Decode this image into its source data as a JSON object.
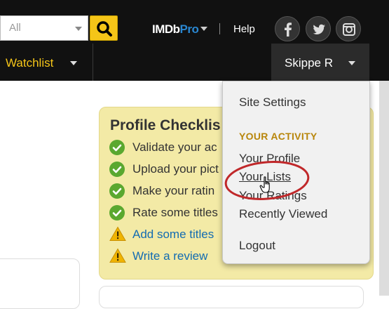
{
  "search": {
    "category_value": "All"
  },
  "header": {
    "pro_logo": {
      "imdb": "IMDb",
      "pro": "Pro"
    },
    "help_label": "Help",
    "social": [
      "facebook-icon",
      "twitter-icon",
      "instagram-icon"
    ]
  },
  "nav": {
    "watchlist_label": "Watchlist",
    "user_name": "Skippe R"
  },
  "profile_checklist": {
    "title": "Profile Checklis",
    "items": [
      {
        "text": "Validate your ac",
        "status": "done"
      },
      {
        "text": "Upload your pict",
        "status": "done"
      },
      {
        "text": "Make your ratin",
        "status": "done"
      },
      {
        "text": "Rate some titles",
        "status": "done"
      },
      {
        "text": "Add some titles",
        "status": "todo"
      },
      {
        "text": "Write a review",
        "status": "todo"
      }
    ]
  },
  "user_dropdown": {
    "site_settings": "Site Settings",
    "section_heading": "YOUR ACTIVITY",
    "your_profile": "Your Profile",
    "your_lists": "Your Lists",
    "your_ratings": "Your Ratings",
    "recently_viewed": "Recently Viewed",
    "logout": "Logout"
  },
  "colors": {
    "header_bg": "#111111",
    "brand_yellow": "#f5c518",
    "checklist_bg": "#f3eaa6",
    "link_blue": "#136cb2",
    "heading_gold": "#b8860b",
    "annotation_red": "#c0282a"
  }
}
